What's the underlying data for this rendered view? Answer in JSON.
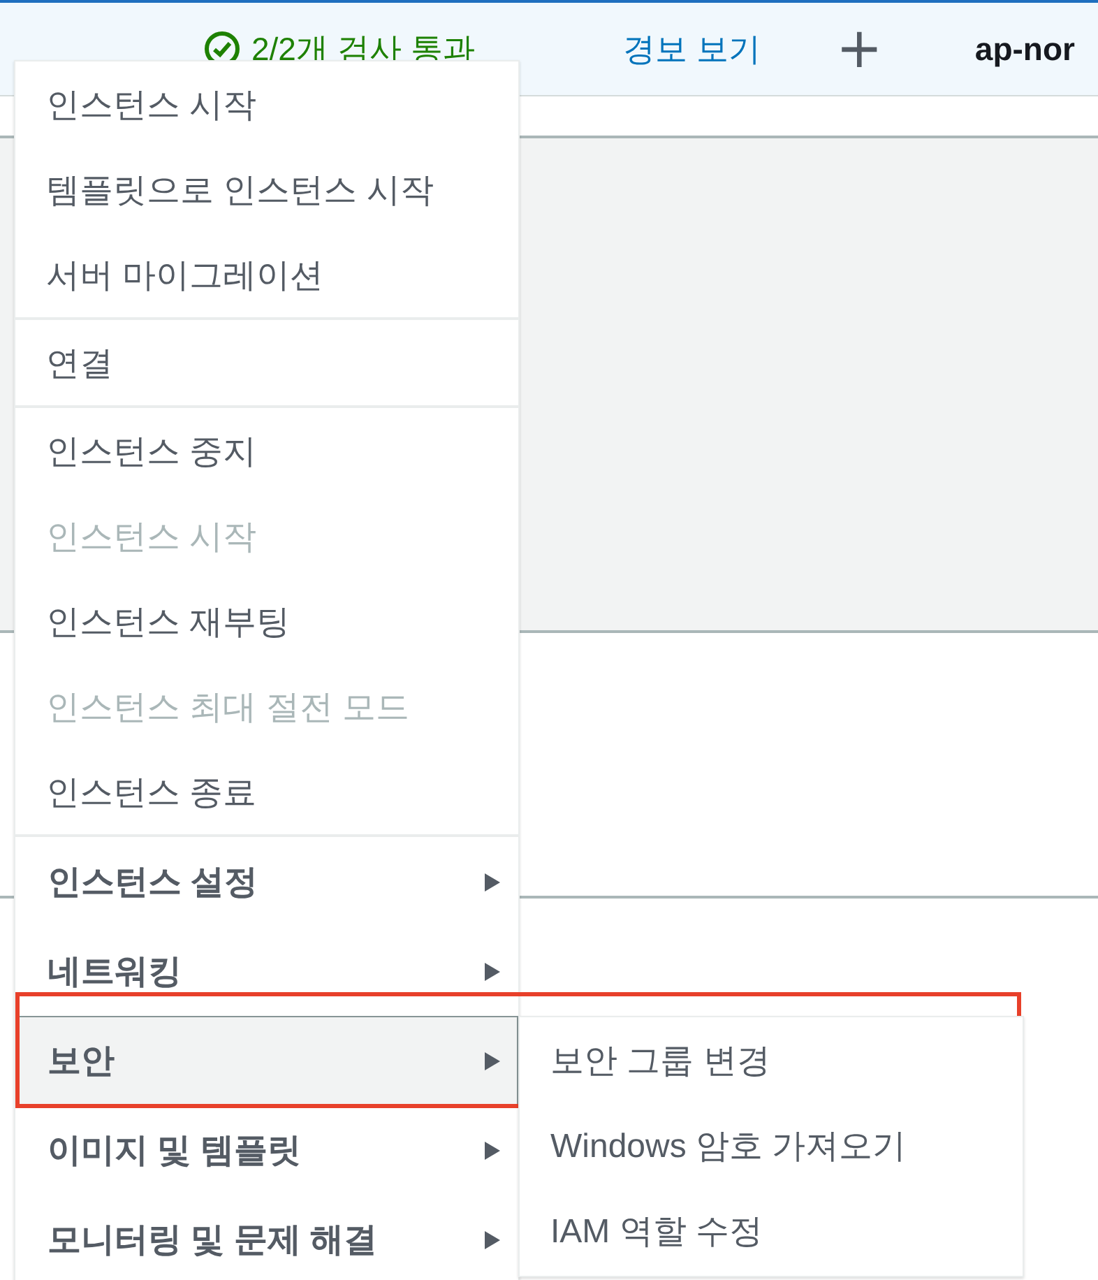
{
  "header": {
    "status": "2/2개 검사 통과",
    "alarm_link": "경보 보기",
    "add_symbol": "+",
    "region": "ap-nor"
  },
  "menu": {
    "groups": [
      {
        "items": [
          {
            "label": "인스턴스 시작",
            "kind": "action",
            "disabled": false
          },
          {
            "label": "템플릿으로 인스턴스 시작",
            "kind": "action",
            "disabled": false
          },
          {
            "label": "서버 마이그레이션",
            "kind": "action",
            "disabled": false
          }
        ]
      },
      {
        "items": [
          {
            "label": "연결",
            "kind": "action",
            "disabled": false
          }
        ]
      },
      {
        "items": [
          {
            "label": "인스턴스 중지",
            "kind": "action",
            "disabled": false
          },
          {
            "label": "인스턴스 시작",
            "kind": "action",
            "disabled": true
          },
          {
            "label": "인스턴스 재부팅",
            "kind": "action",
            "disabled": false
          },
          {
            "label": "인스턴스 최대 절전 모드",
            "kind": "action",
            "disabled": true
          },
          {
            "label": "인스턴스 종료",
            "kind": "action",
            "disabled": false
          }
        ]
      },
      {
        "items": [
          {
            "label": "인스턴스 설정",
            "kind": "submenu",
            "selected": false
          },
          {
            "label": "네트워킹",
            "kind": "submenu",
            "selected": false
          },
          {
            "label": "보안",
            "kind": "submenu",
            "selected": true,
            "highlighted": true,
            "children": [
              {
                "label": "보안 그룹 변경"
              },
              {
                "label": "Windows 암호 가져오기"
              },
              {
                "label": "IAM 역할 수정"
              }
            ]
          },
          {
            "label": "이미지 및 템플릿",
            "kind": "submenu",
            "selected": false
          },
          {
            "label": "모니터링 및 문제 해결",
            "kind": "submenu",
            "selected": false
          }
        ]
      }
    ]
  }
}
